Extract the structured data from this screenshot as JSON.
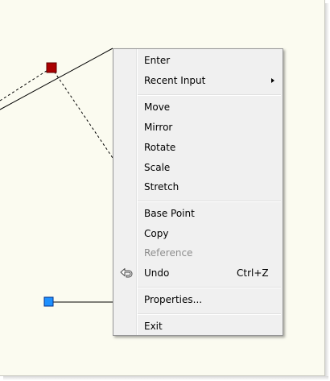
{
  "context_menu": {
    "items": [
      {
        "label": "Enter"
      },
      {
        "label": "Recent Input"
      },
      {
        "label": "Move"
      },
      {
        "label": "Mirror"
      },
      {
        "label": "Rotate"
      },
      {
        "label": "Scale"
      },
      {
        "label": "Stretch"
      },
      {
        "label": "Base Point"
      },
      {
        "label": "Copy"
      },
      {
        "label": "Reference",
        "disabled": true
      },
      {
        "label": "Undo",
        "shortcut": "Ctrl+Z",
        "icon": "undo-arrow-icon"
      },
      {
        "label": "Properties..."
      },
      {
        "label": "Exit"
      }
    ],
    "submenu_indicator_icon": "chevron-right-icon"
  },
  "colors": {
    "canvas_background": "#fbfbf0",
    "menu_background": "#f0f0f0",
    "grip_selected": "#aa0000",
    "grip_unselected": "#1e90ff",
    "disabled_text": "#8d8d8d"
  }
}
